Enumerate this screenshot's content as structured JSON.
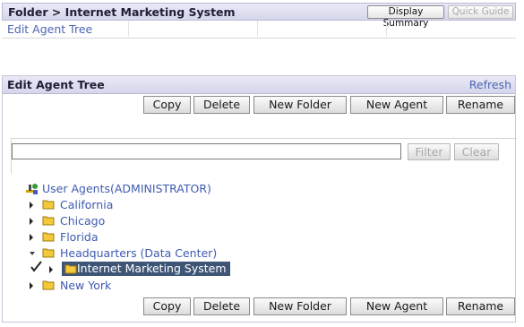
{
  "header": {
    "breadcrumb": "Folder > Internet Marketing System",
    "display_summary_label": "Display Summary",
    "quick_guide_label": "Quick Guide",
    "edit_agent_tree_link": "Edit Agent Tree"
  },
  "panel": {
    "title": "Edit Agent Tree",
    "refresh_label": "Refresh"
  },
  "toolbar": {
    "copy": "Copy",
    "delete": "Delete",
    "new_folder": "New Folder",
    "new_agent": "New Agent",
    "rename": "Rename"
  },
  "filter": {
    "input_value": "",
    "filter_label": "Filter",
    "clear_label": "Clear"
  },
  "tree": {
    "root": "User Agents(ADMINISTRATOR)",
    "items": [
      {
        "label": "California",
        "expanded": false
      },
      {
        "label": "Chicago",
        "expanded": false
      },
      {
        "label": "Florida",
        "expanded": false
      },
      {
        "label": "Headquarters (Data Center)",
        "expanded": true
      },
      {
        "label": "Internet Marketing System",
        "selected": true,
        "checked": true
      },
      {
        "label": "New York",
        "expanded": false
      }
    ]
  },
  "colors": {
    "link": "#3e5bb0",
    "header_bg": "#dcdcef",
    "selected_bg": "#3f5576",
    "folder": "#e8b926"
  }
}
